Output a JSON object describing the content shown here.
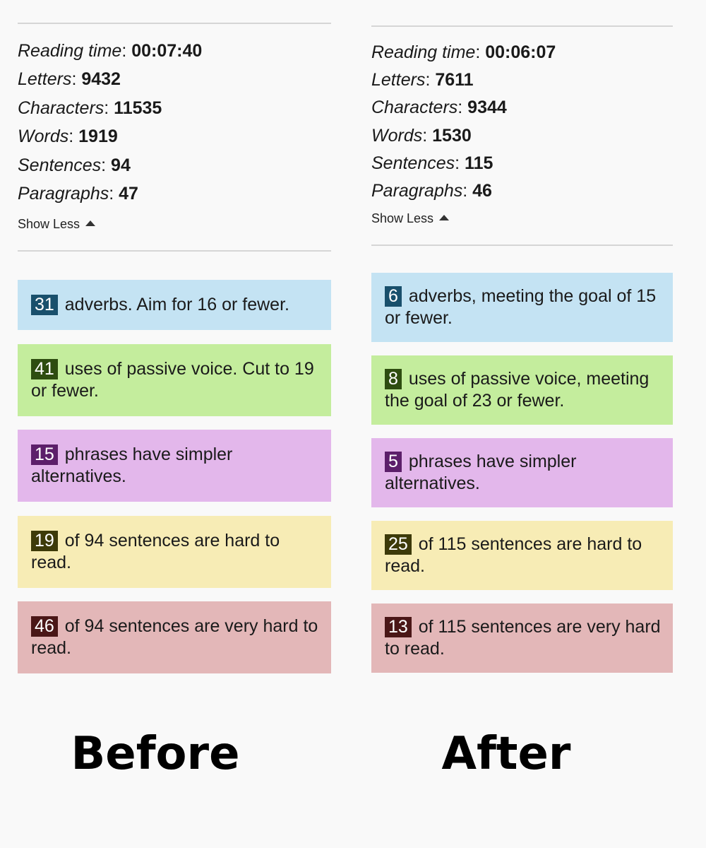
{
  "before": {
    "caption": "Before",
    "stats": [
      {
        "label": "Reading time",
        "value": "00:07:40"
      },
      {
        "label": "Letters",
        "value": "9432"
      },
      {
        "label": "Characters",
        "value": "11535"
      },
      {
        "label": "Words",
        "value": "1919"
      },
      {
        "label": "Sentences",
        "value": "94"
      },
      {
        "label": "Paragraphs",
        "value": "47"
      }
    ],
    "show_less": "Show Less",
    "cards": [
      {
        "count": "31",
        "text": "adverbs. Aim for 16 or fewer."
      },
      {
        "count": "41",
        "text": "uses of passive voice. Cut to 19 or fewer."
      },
      {
        "count": "15",
        "text": "phrases have simpler alternatives."
      },
      {
        "count": "19",
        "text": "of 94 sentences are hard to read."
      },
      {
        "count": "46",
        "text": "of 94 sentences are very hard to read."
      }
    ]
  },
  "after": {
    "caption": "After",
    "stats": [
      {
        "label": "Reading time",
        "value": "00:06:07"
      },
      {
        "label": "Letters",
        "value": "7611"
      },
      {
        "label": "Characters",
        "value": "9344"
      },
      {
        "label": "Words",
        "value": "1530"
      },
      {
        "label": "Sentences",
        "value": "115"
      },
      {
        "label": "Paragraphs",
        "value": "46"
      }
    ],
    "show_less": "Show Less",
    "cards": [
      {
        "count": "6",
        "text": "adverbs, meeting the goal of 15 or fewer."
      },
      {
        "count": "8",
        "text": "uses of passive voice, meeting the goal of 23 or fewer."
      },
      {
        "count": "5",
        "text": "phrases have simpler alternatives."
      },
      {
        "count": "25",
        "text": "of 115 sentences are hard to read."
      },
      {
        "count": "13",
        "text": "of 115 sentences are very hard to read."
      }
    ]
  },
  "colors": {
    "adverbs": "#c4e3f3",
    "passive_voice": "#c4ed9d",
    "simpler_alternatives": "#e3b7eb",
    "hard_to_read": "#f7ecb5",
    "very_hard_to_read": "#e3b7b8"
  }
}
